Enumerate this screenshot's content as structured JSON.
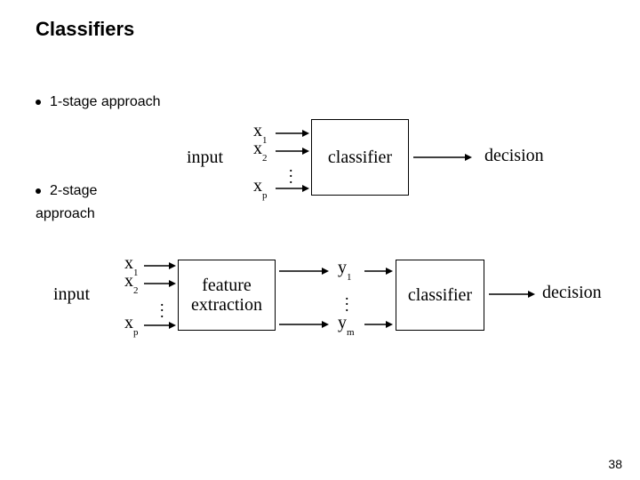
{
  "title": "Classifiers",
  "bullets": {
    "b1": "1-stage approach",
    "b2": "2-stage",
    "b2b": "approach"
  },
  "stage1": {
    "input": "input",
    "x1": "x",
    "x1sub": "1",
    "x2": "x",
    "x2sub": "2",
    "xp": "x",
    "xpsub": "p",
    "classifier": "classifier",
    "decision": "decision"
  },
  "stage2": {
    "input": "input",
    "x1": "x",
    "x1sub": "1",
    "x2": "x",
    "x2sub": "2",
    "xp": "x",
    "xpsub": "p",
    "feature": "feature\nextraction",
    "y1": "y",
    "y1sub": "1",
    "ym": "y",
    "ymsub": "m",
    "classifier": "classifier",
    "decision": "decision"
  },
  "page": "38"
}
